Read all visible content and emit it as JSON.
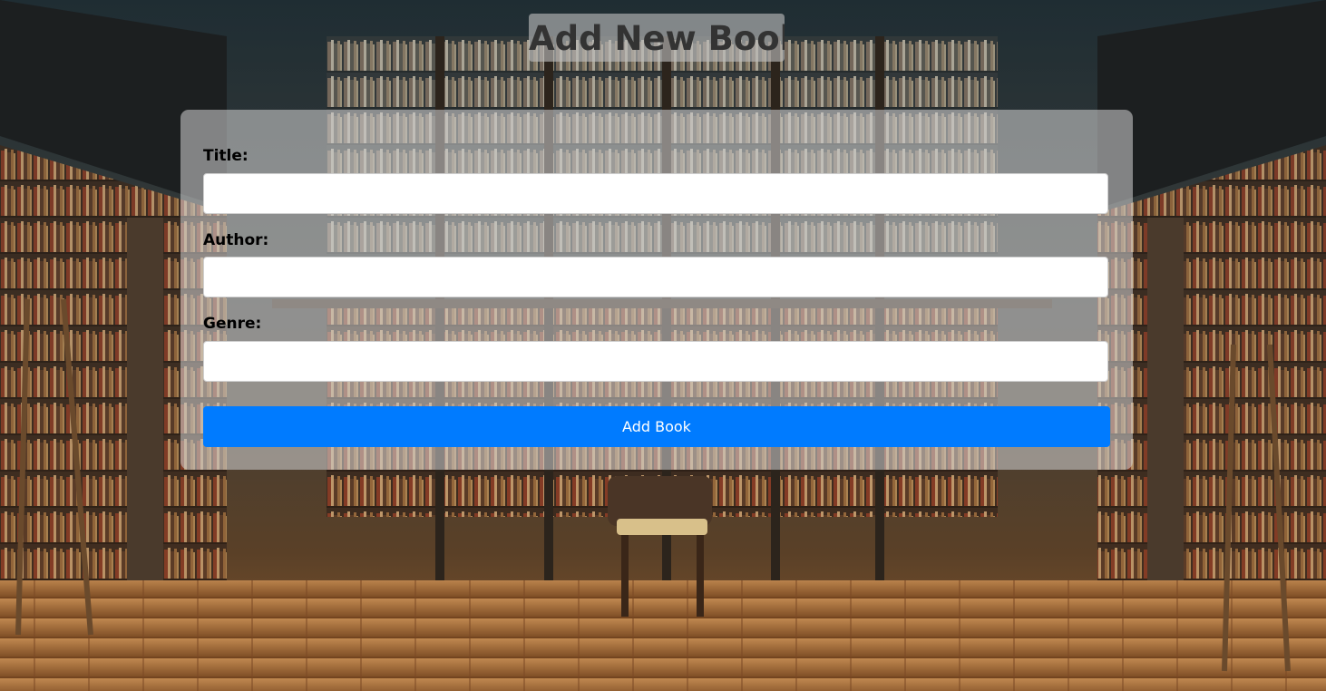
{
  "page": {
    "title": "Add New Book"
  },
  "form": {
    "fields": [
      {
        "label": "Title:",
        "value": "",
        "placeholder": ""
      },
      {
        "label": "Author:",
        "value": "",
        "placeholder": ""
      },
      {
        "label": "Genre:",
        "value": "",
        "placeholder": ""
      }
    ],
    "submit_label": "Add Book"
  },
  "colors": {
    "accent": "#007bff",
    "title_text": "#333333"
  },
  "background": {
    "description_icon": "library-background-image"
  }
}
